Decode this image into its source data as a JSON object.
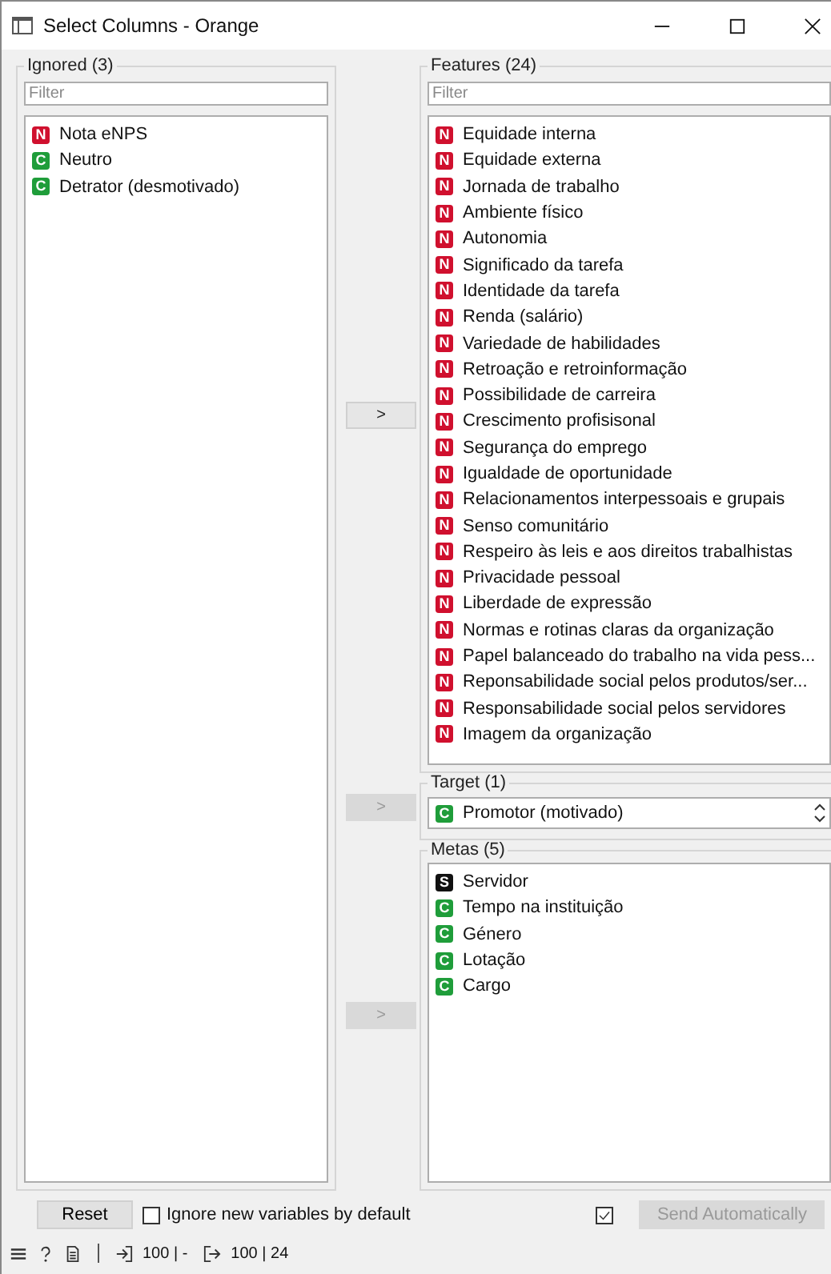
{
  "window": {
    "title": "Select Columns - Orange"
  },
  "ignored": {
    "title": "Ignored (3)",
    "filter": {
      "placeholder": "Filter"
    },
    "items": [
      {
        "badge": "N",
        "color": "#d0102e",
        "name": "Nota eNPS"
      },
      {
        "badge": "C",
        "color": "#1f9d3a",
        "name": "Neutro"
      },
      {
        "badge": "C",
        "color": "#1f9d3a",
        "name": "Detrator (desmotivado)"
      }
    ]
  },
  "move_buttons": [
    {
      "label": ">",
      "disabled": false
    },
    {
      "label": ">",
      "disabled": true
    },
    {
      "label": ">",
      "disabled": true
    }
  ],
  "features": {
    "title": "Features (24)",
    "filter": {
      "placeholder": "Filter"
    },
    "items": [
      {
        "badge": "N",
        "color": "#d0102e",
        "name": "Equidade interna"
      },
      {
        "badge": "N",
        "color": "#d0102e",
        "name": "Equidade externa"
      },
      {
        "badge": "N",
        "color": "#d0102e",
        "name": "Jornada de trabalho"
      },
      {
        "badge": "N",
        "color": "#d0102e",
        "name": "Ambiente físico"
      },
      {
        "badge": "N",
        "color": "#d0102e",
        "name": "Autonomia"
      },
      {
        "badge": "N",
        "color": "#d0102e",
        "name": "Significado da tarefa"
      },
      {
        "badge": "N",
        "color": "#d0102e",
        "name": "Identidade da tarefa"
      },
      {
        "badge": "N",
        "color": "#d0102e",
        "name": "Renda (salário)"
      },
      {
        "badge": "N",
        "color": "#d0102e",
        "name": "Variedade de habilidades"
      },
      {
        "badge": "N",
        "color": "#d0102e",
        "name": "Retroação e retroinformação"
      },
      {
        "badge": "N",
        "color": "#d0102e",
        "name": "Possibilidade de carreira"
      },
      {
        "badge": "N",
        "color": "#d0102e",
        "name": "Crescimento profisisonal"
      },
      {
        "badge": "N",
        "color": "#d0102e",
        "name": "Segurança do emprego"
      },
      {
        "badge": "N",
        "color": "#d0102e",
        "name": "Igualdade de oportunidade"
      },
      {
        "badge": "N",
        "color": "#d0102e",
        "name": "Relacionamentos interpessoais e grupais"
      },
      {
        "badge": "N",
        "color": "#d0102e",
        "name": "Senso comunitário"
      },
      {
        "badge": "N",
        "color": "#d0102e",
        "name": "Respeiro às leis e aos direitos trabalhistas"
      },
      {
        "badge": "N",
        "color": "#d0102e",
        "name": "Privacidade pessoal"
      },
      {
        "badge": "N",
        "color": "#d0102e",
        "name": "Liberdade de expressão"
      },
      {
        "badge": "N",
        "color": "#d0102e",
        "name": "Normas e rotinas claras da organização"
      },
      {
        "badge": "N",
        "color": "#d0102e",
        "name": "Papel balanceado do trabalho na vida pess..."
      },
      {
        "badge": "N",
        "color": "#d0102e",
        "name": "Reponsabilidade social pelos produtos/ser..."
      },
      {
        "badge": "N",
        "color": "#d0102e",
        "name": "Responsabilidade social pelos servidores"
      },
      {
        "badge": "N",
        "color": "#d0102e",
        "name": "Imagem da organização"
      }
    ]
  },
  "target": {
    "title": "Target (1)",
    "value": {
      "badge": "C",
      "color": "#1f9d3a",
      "name": "Promotor (motivado)"
    }
  },
  "metas": {
    "title": "Metas (5)",
    "items": [
      {
        "badge": "S",
        "color": "#111111",
        "name": "Servidor"
      },
      {
        "badge": "C",
        "color": "#1f9d3a",
        "name": "Tempo na instituição"
      },
      {
        "badge": "C",
        "color": "#1f9d3a",
        "name": "Género"
      },
      {
        "badge": "C",
        "color": "#1f9d3a",
        "name": "Lotação"
      },
      {
        "badge": "C",
        "color": "#1f9d3a",
        "name": "Cargo"
      }
    ]
  },
  "reset_button": "Reset",
  "ignore_new": {
    "label": "Ignore new variables by default",
    "checked": false
  },
  "send_automatically": {
    "label": "Send Automatically",
    "checked": true,
    "disabled": true
  },
  "status_bar": {
    "input_summary": "100 | -",
    "output_summary": "100 | 24"
  }
}
